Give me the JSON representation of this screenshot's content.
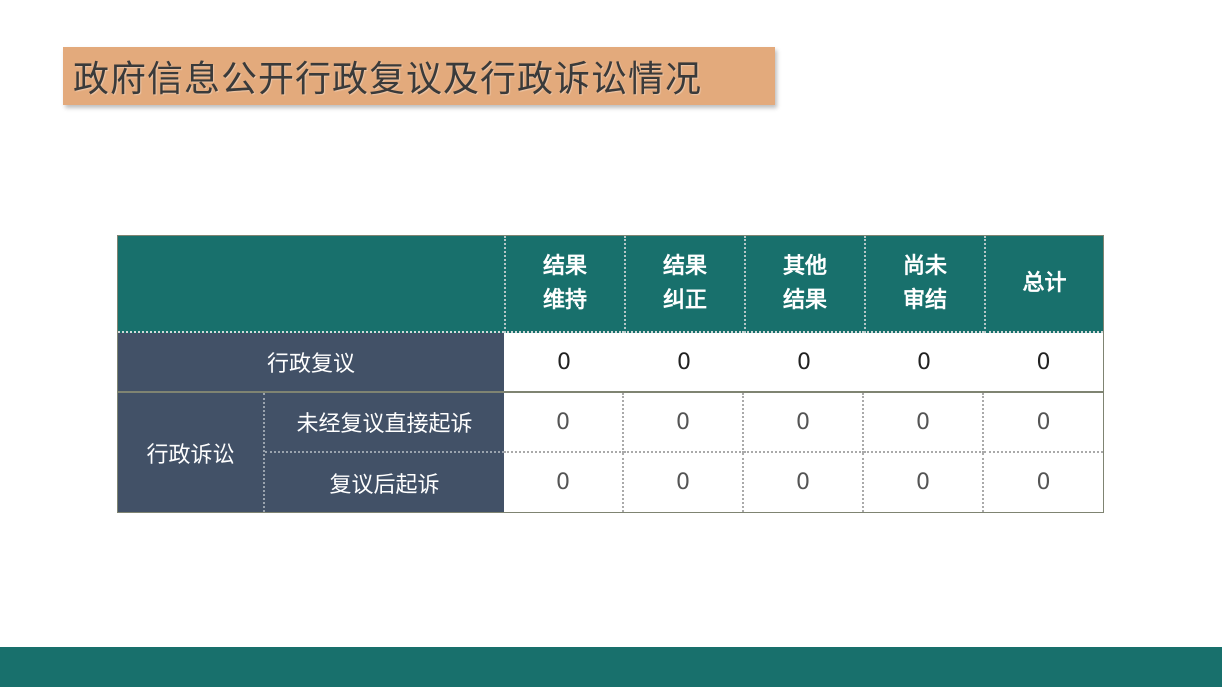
{
  "title": "政府信息公开行政复议及行政诉讼情况",
  "table": {
    "columns": [
      "结果\n维持",
      "结果\n纠正",
      "其他\n结果",
      "尚未\n审结",
      "总计"
    ],
    "rows": {
      "review": {
        "label": "行政复议",
        "values": [
          "0",
          "0",
          "0",
          "0",
          "0"
        ]
      },
      "litigation": {
        "label": "行政诉讼",
        "sub": [
          {
            "label": "未经复议直接起诉",
            "values": [
              "0",
              "0",
              "0",
              "0",
              "0"
            ]
          },
          {
            "label": "复议后起诉",
            "values": [
              "0",
              "0",
              "0",
              "0",
              "0"
            ]
          }
        ]
      }
    }
  },
  "colors": {
    "header": "#18706c",
    "side": "#425167",
    "title_bg": "#e3aa7c",
    "footer": "#18706c"
  }
}
